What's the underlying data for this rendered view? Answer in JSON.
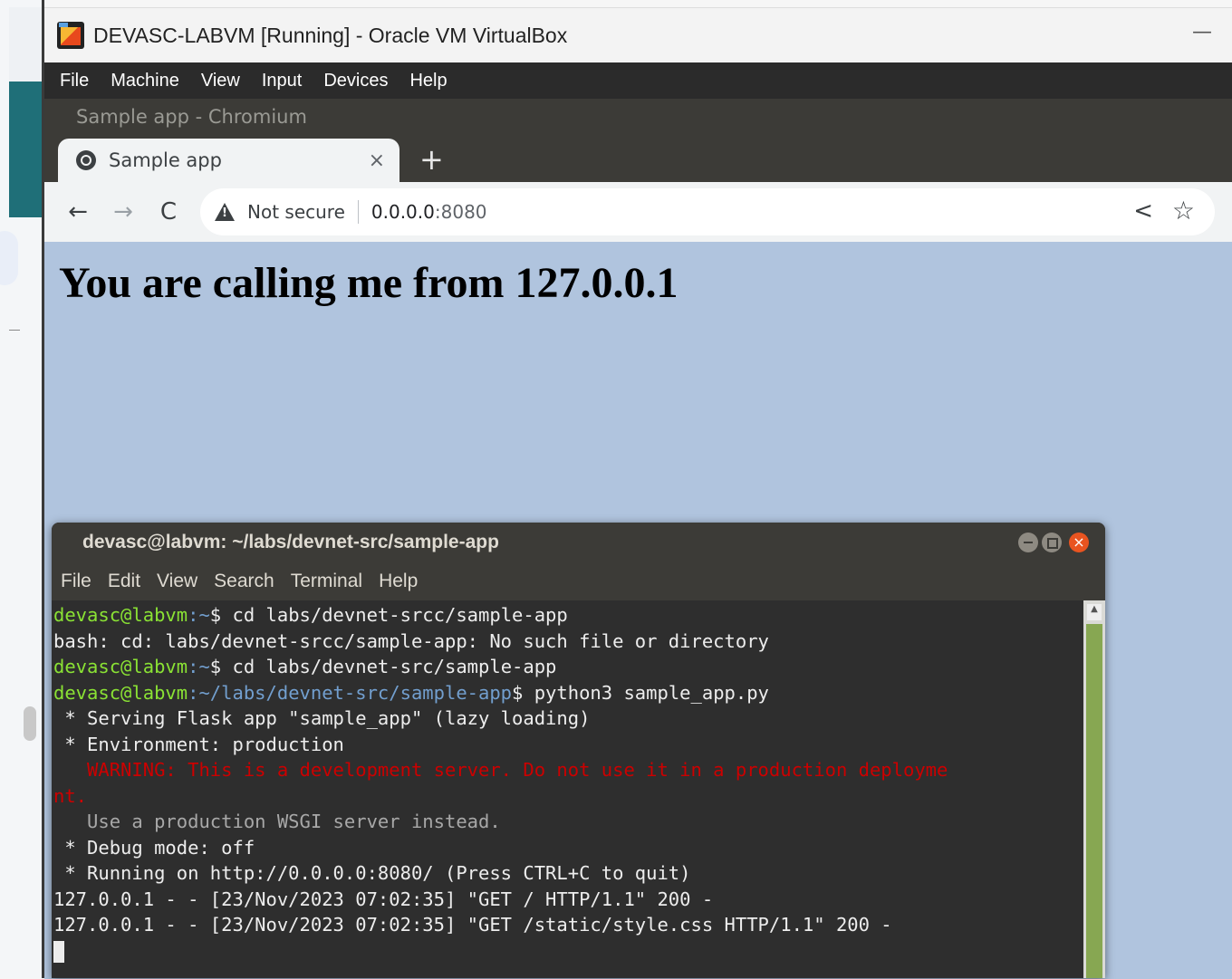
{
  "vbox": {
    "title": "DEVASC-LABVM [Running] - Oracle VM VirtualBox",
    "minimize": "—",
    "menu": [
      "File",
      "Machine",
      "View",
      "Input",
      "Devices",
      "Help"
    ]
  },
  "browser": {
    "window_title": "Sample app - Chromium",
    "tab_title": "Sample app",
    "tab_close": "×",
    "new_tab": "+",
    "nav": {
      "back": "←",
      "forward": "→",
      "reload": "C"
    },
    "security_label": "Not secure",
    "url_host": "0.0.0.0",
    "url_port": ":8080",
    "share": "<",
    "bookmark": "☆",
    "heading": "You are calling me from 127.0.0.1"
  },
  "terminal": {
    "title": "devasc@labvm: ~/labs/devnet-src/sample-app",
    "menu": [
      "File",
      "Edit",
      "View",
      "Search",
      "Terminal",
      "Help"
    ],
    "close_glyph": "×",
    "lines": {
      "l1_user": "devasc@labvm",
      "l1_path": ":~",
      "l1_cmd": "$ cd labs/devnet-srcc/sample-app",
      "l2": "bash: cd: labs/devnet-srcc/sample-app: No such file or directory",
      "l3_user": "devasc@labvm",
      "l3_path": ":~",
      "l3_cmd": "$ cd labs/devnet-src/sample-app",
      "l4_user": "devasc@labvm",
      "l4_path": ":~/labs/devnet-src/sample-app",
      "l4_cmd": "$ python3 sample_app.py",
      "l5": " * Serving Flask app \"sample_app\" (lazy loading)",
      "l6": " * Environment: production",
      "l7": "   WARNING: This is a development server. Do not use it in a production deployme",
      "l8": "nt.",
      "l9": "   Use a production WSGI server instead.",
      "l10": " * Debug mode: off",
      "l11": " * Running on http://0.0.0.0:8080/ (Press CTRL+C to quit)",
      "l12": "127.0.0.1 - - [23/Nov/2023 07:02:35] \"GET / HTTP/1.1\" 200 -",
      "l13": "127.0.0.1 - - [23/Nov/2023 07:02:35] \"GET /static/style.css HTTP/1.1\" 200 -"
    }
  },
  "colors": {
    "page_bg": "#b0c4de",
    "prompt_user": "#8ae234",
    "prompt_path": "#729fcf",
    "warning": "#cc0000",
    "scroll_thumb": "#87a752"
  }
}
